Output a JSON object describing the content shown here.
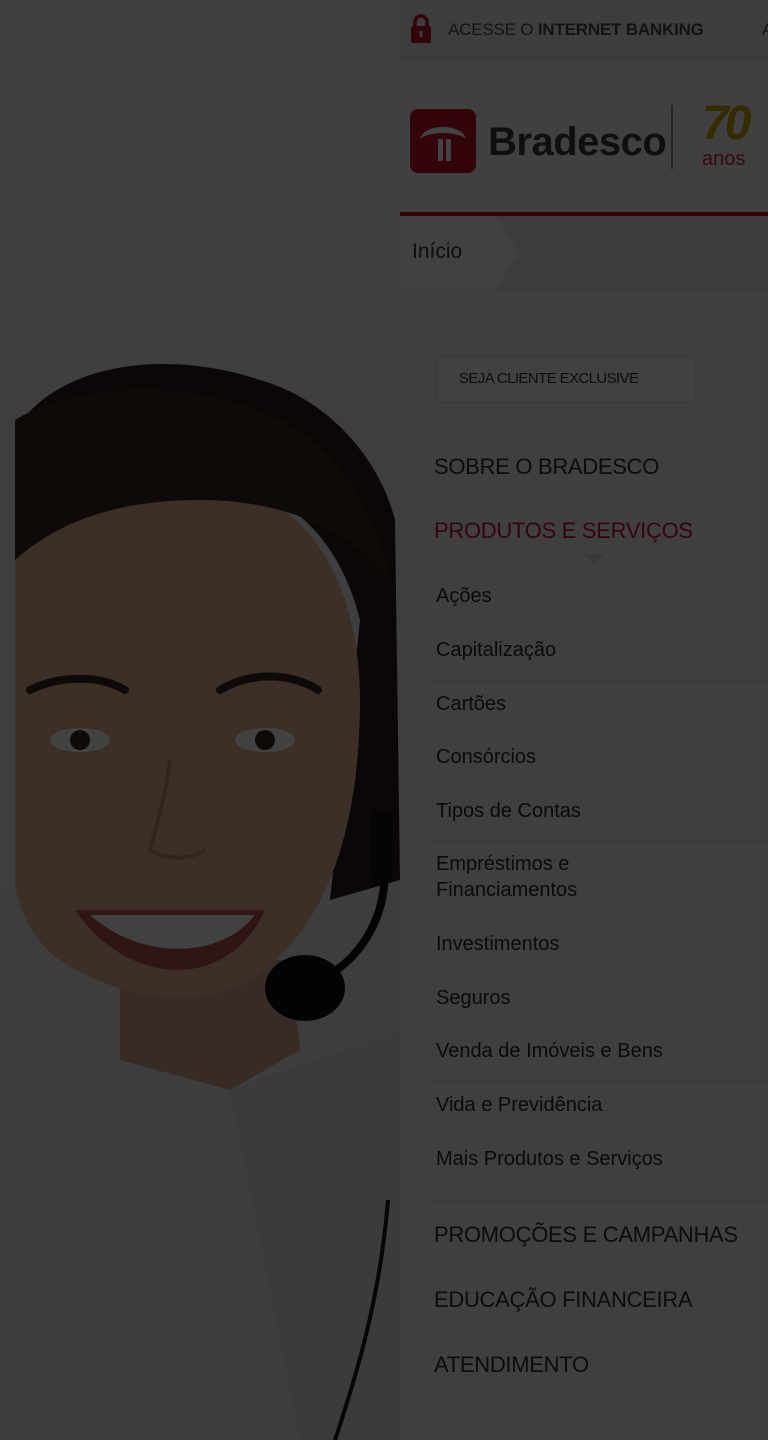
{
  "topbar": {
    "lock_icon": "lock-icon",
    "link_prefix": "ACESSE O ",
    "link_bold": "INTERNET BANKING",
    "extra": "A"
  },
  "header": {
    "brand": "Bradesco",
    "anniversary_number": "70",
    "anniversary_word": "anos",
    "brand_color": "#c4122f"
  },
  "breadcrumb": {
    "home": "Início"
  },
  "cta": {
    "label": "SEJA CLIENTE EXCLUSIVE"
  },
  "menu": {
    "about": "SOBRE O BRADESCO",
    "products": "PRODUTOS E SERVIÇOS",
    "products_items": [
      "Ações",
      "Capitalização",
      "Cartões",
      "Consórcios",
      "Tipos de Contas",
      "Empréstimos e Financiamentos",
      "Investimentos",
      "Seguros",
      "Venda de Imóveis e Bens",
      "Vida e Previdência",
      "Mais Produtos e Serviços"
    ],
    "promotions": "PROMOÇÕES E CAMPANHAS",
    "education": "EDUCAÇÃO FINANCEIRA",
    "support": "ATENDIMENTO"
  }
}
